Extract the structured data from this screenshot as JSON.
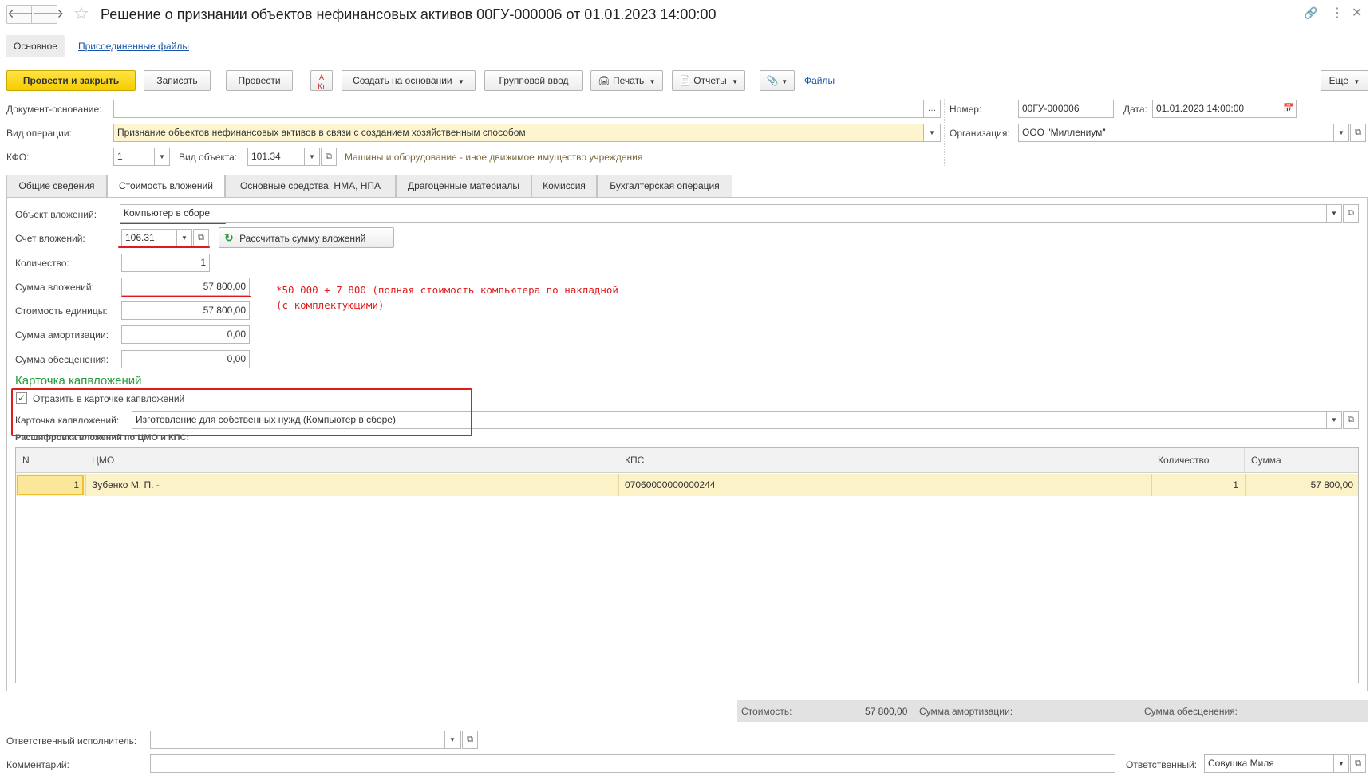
{
  "window": {
    "title": "Решение о признании объектов нефинансовых активов 00ГУ-000006 от 01.01.2023 14:00:00"
  },
  "nav_tabs": {
    "main": "Основное",
    "files": "Присоединенные файлы"
  },
  "toolbar": {
    "post_close": "Провести и закрыть",
    "save": "Записать",
    "post": "Провести",
    "create_based": "Создать на основании",
    "group_input": "Групповой ввод",
    "print": "Печать",
    "reports": "Отчеты",
    "files_link": "Файлы",
    "more": "Еще"
  },
  "header": {
    "doc_basis_label": "Документ-основание:",
    "doc_basis_value": "",
    "op_type_label": "Вид операции:",
    "op_type_value": "Признание объектов нефинансовых активов в связи с созданием хозяйственным способом",
    "kfo_label": "КФО:",
    "kfo_value": "1",
    "obj_type_label": "Вид объекта:",
    "obj_type_value": "101.34",
    "obj_type_desc": "Машины и оборудование - иное движимое имущество учреждения",
    "number_label": "Номер:",
    "number_value": "00ГУ-000006",
    "date_label": "Дата:",
    "date_value": "01.01.2023 14:00:00",
    "org_label": "Организация:",
    "org_value": "ООО \"Миллениум\""
  },
  "tabs": [
    "Общие сведения",
    "Стоимость вложений",
    "Основные средства, НМА, НПА",
    "Драгоценные материалы",
    "Комиссия",
    "Бухгалтерская операция"
  ],
  "invest": {
    "object_label": "Объект вложений:",
    "object_value": "Компьютер в сборе",
    "account_label": "Счет вложений:",
    "account_value": "106.31",
    "calc_button": "Рассчитать сумму вложений",
    "qty_label": "Количество:",
    "qty_value": "1",
    "sum_label": "Сумма вложений:",
    "sum_value": "57 800,00",
    "unit_cost_label": "Стоимость единицы:",
    "unit_cost_value": "57 800,00",
    "amort_label": "Сумма амортизации:",
    "amort_value": "0,00",
    "impair_label": "Сумма обесценения:",
    "impair_value": "0,00",
    "note_line1": "*50 000 + 7 800 (полная стоимость компьютера по накладной",
    "note_line2": "(с комплектующими)"
  },
  "card": {
    "section_title": "Карточка капвложений",
    "reflect_label": "Отразить в карточке капвложений",
    "reflect_checked": true,
    "card_label": "Карточка капвложений:",
    "card_value": "Изготовление для собственных нужд (Компьютер в сборе)",
    "breakdown_title": "Расшифровка вложений по ЦМО и КПС:"
  },
  "grid": {
    "columns": [
      "N",
      "ЦМО",
      "КПС",
      "Количество",
      "Сумма"
    ],
    "rows": [
      {
        "n": "1",
        "cmo": "Зубенко М. П. -",
        "kps": "07060000000000244",
        "qty": "1",
        "sum": "57 800,00"
      }
    ]
  },
  "totals": {
    "cost_label": "Стоимость:",
    "cost_value": "57 800,00",
    "amort_label": "Сумма амортизации:",
    "impair_label": "Сумма обесценения:"
  },
  "footer": {
    "executor_label": "Ответственный исполнитель:",
    "executor_value": "",
    "comment_label": "Комментарий:",
    "comment_value": "",
    "responsible_label": "Ответственный:",
    "responsible_value": "Совушка Миля"
  },
  "colors": {
    "accent_yellow": "#f6cd00",
    "annotation_red": "#e01b1b",
    "section_green": "#2a9a3e",
    "row_highlight": "#fbf2c8"
  }
}
